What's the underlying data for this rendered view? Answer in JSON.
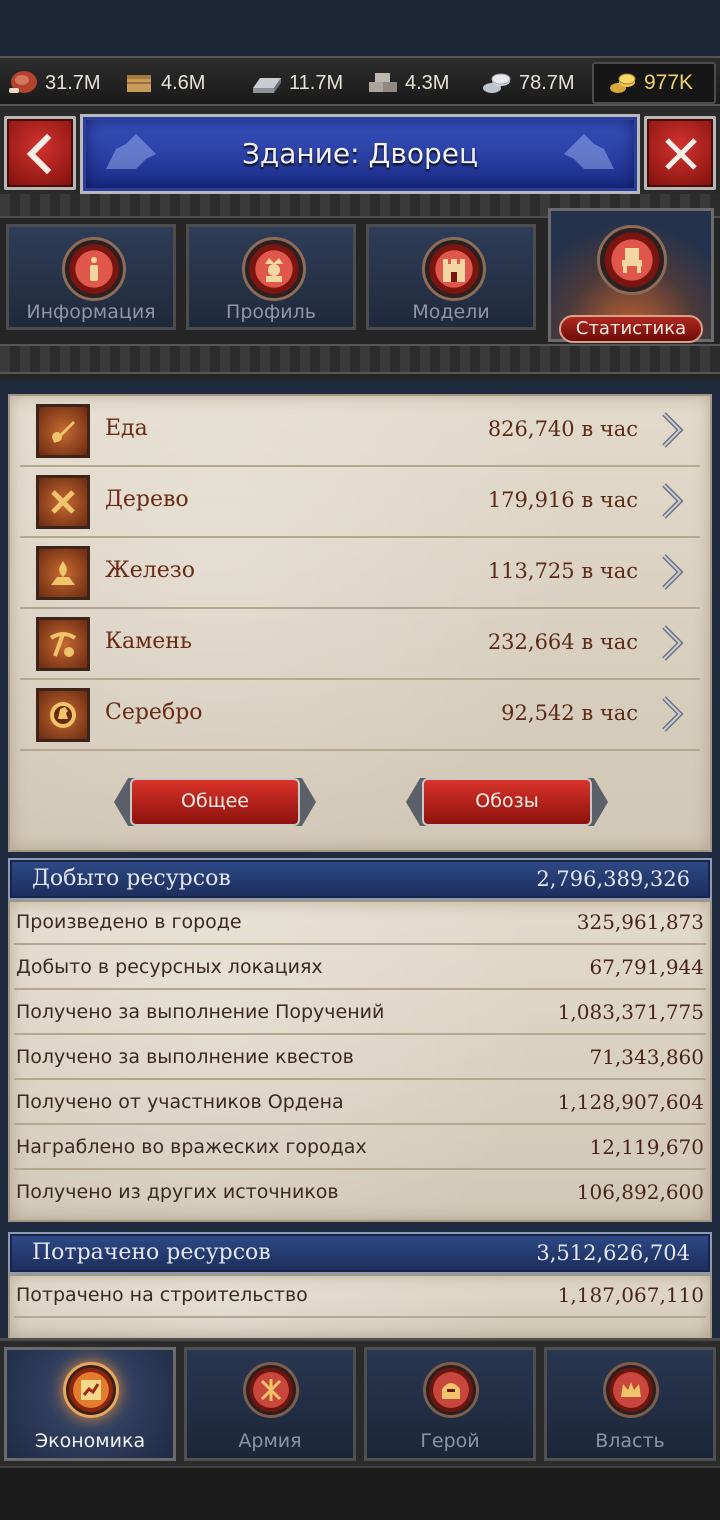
{
  "resources_bar": {
    "meat": "31.7M",
    "wood": "4.6M",
    "iron": "11.7M",
    "stone": "4.3M",
    "silver": "78.7M",
    "gold": "977K"
  },
  "header": {
    "title": "Здание: Дворец"
  },
  "tabs": [
    {
      "label": "Информация"
    },
    {
      "label": "Профиль"
    },
    {
      "label": "Модели"
    },
    {
      "label": "Статистика",
      "active": true
    }
  ],
  "production": [
    {
      "name": "Еда",
      "value": "826,740 в час",
      "icon": "food-icon"
    },
    {
      "name": "Дерево",
      "value": "179,916 в час",
      "icon": "wood-icon"
    },
    {
      "name": "Железо",
      "value": "113,725 в час",
      "icon": "iron-icon"
    },
    {
      "name": "Камень",
      "value": "232,664 в час",
      "icon": "stone-icon"
    },
    {
      "name": "Серебро",
      "value": "92,542 в час",
      "icon": "silver-icon"
    }
  ],
  "buttons": {
    "general": "Общее",
    "convoys": "Обозы"
  },
  "mined": {
    "title": "Добыто ресурсов",
    "total": "2,796,389,326",
    "rows": [
      {
        "label": "Произведено в городе",
        "value": "325,961,873"
      },
      {
        "label": "Добыто в ресурсных локациях",
        "value": "67,791,944"
      },
      {
        "label": "Получено за выполнение Поручений",
        "value": "1,083,371,775"
      },
      {
        "label": "Получено за выполнение квестов",
        "value": "71,343,860"
      },
      {
        "label": "Получено от участников Ордена",
        "value": "1,128,907,604"
      },
      {
        "label": "Награблено во вражеских городах",
        "value": "12,119,670"
      },
      {
        "label": "Получено из других источников",
        "value": "106,892,600"
      }
    ]
  },
  "spent": {
    "title": "Потрачено ресурсов",
    "total": "3,512,626,704",
    "rows": [
      {
        "label": "Потрачено на строительство",
        "value": "1,187,067,110"
      }
    ]
  },
  "bottom_nav": [
    {
      "label": "Экономика",
      "active": true
    },
    {
      "label": "Армия"
    },
    {
      "label": "Герой"
    },
    {
      "label": "Власть"
    }
  ]
}
